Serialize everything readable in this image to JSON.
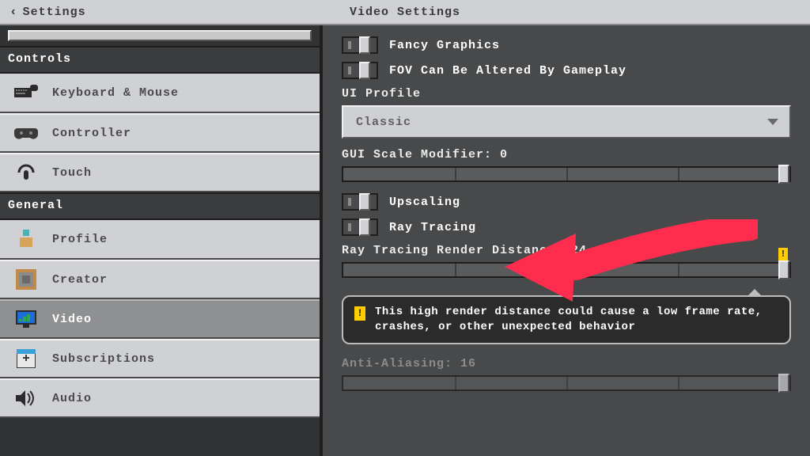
{
  "topbar": {
    "back_label": "Settings",
    "title": "Video Settings"
  },
  "sidebar": {
    "section_controls": "Controls",
    "section_general": "General",
    "items": {
      "keyboard": "Keyboard & Mouse",
      "controller": "Controller",
      "touch": "Touch",
      "profile": "Profile",
      "creator": "Creator",
      "video": "Video",
      "subscriptions": "Subscriptions",
      "audio": "Audio"
    }
  },
  "content": {
    "fancy_graphics": "Fancy Graphics",
    "fov_gameplay": "FOV Can Be Altered By Gameplay",
    "ui_profile_label": "UI Profile",
    "ui_profile_value": "Classic",
    "gui_scale_label": "GUI Scale Modifier: 0",
    "upscaling": "Upscaling",
    "ray_tracing": "Ray Tracing",
    "rt_render_label": "Ray Tracing Render Distance: 24 chunks",
    "warning_text": "This high render distance could cause a low frame rate, crashes, or other unexpected behavior",
    "anti_aliasing_label": "Anti-Aliasing: 16"
  }
}
